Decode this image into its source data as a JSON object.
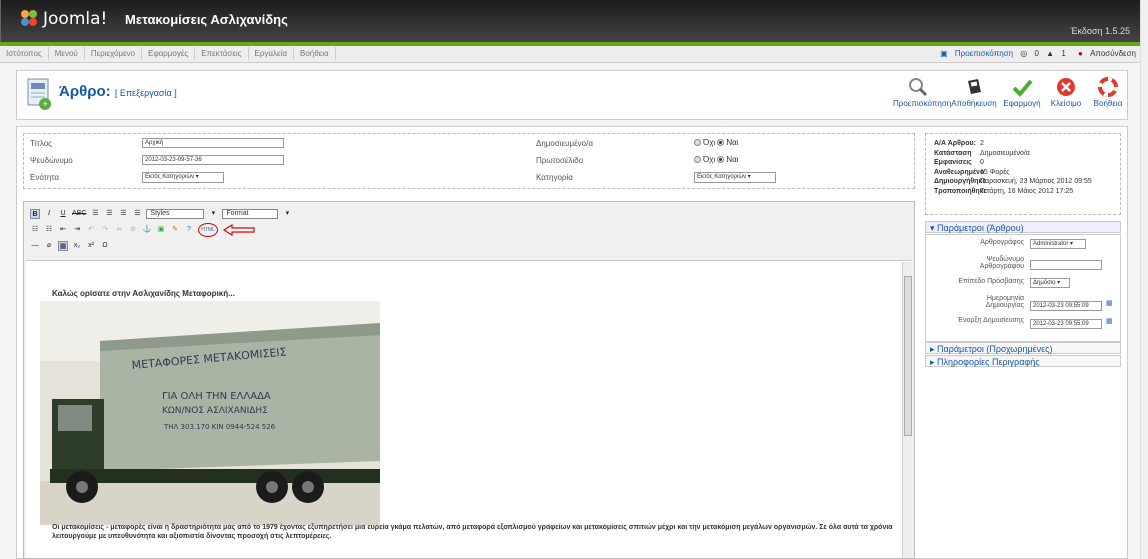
{
  "header": {
    "logo_text": "Joomla!",
    "site_name": "Μετακομίσεις Ασλιχανίδης",
    "version": "Έκδοση 1.5.25"
  },
  "menu": {
    "items": [
      "Ιστότοπος",
      "Μενού",
      "Περιεχόμενο",
      "Εφαρμογές",
      "Επεκτάσεις",
      "Εργαλεία",
      "Βοήθεια"
    ],
    "preview": "Προεπισκόπηση",
    "count1": "0",
    "count2": "1",
    "logout": "Αποσύνδεση"
  },
  "toolbar": {
    "title": "Άρθρο:",
    "subtitle": "[ Επεξεργασία ]",
    "buttons": [
      "Προεπισκόπηση",
      "Αποθήκευση",
      "Εφαρμογή",
      "Κλείσιμο",
      "Βοήθεια"
    ]
  },
  "form": {
    "title_label": "Τίτλος",
    "title_value": "Αρχική",
    "alias_label": "Ψευδώνυμο",
    "alias_value": "2012-03-23-09-57-36",
    "section_label": "Ενότητα",
    "section_value": "Εκτός Κατηγοριών",
    "published_label": "Δημοσιευμένο/α",
    "frontpage_label": "Πρωτοσέλιδο",
    "category_label": "Κατηγορία",
    "category_value": "Εκτός Κατηγοριών",
    "no": "Όχι",
    "yes": "Ναι"
  },
  "info": {
    "rows": [
      {
        "k": "Α/Α Άρθρου:",
        "v": "2"
      },
      {
        "k": "Κατάσταση",
        "v": "Δημοσιευμένο/α"
      },
      {
        "k": "Εμφανίσεις",
        "v": "0"
      },
      {
        "k": "Αναθεωρημένο",
        "v": "15 Φορές"
      },
      {
        "k": "Δημιουργήθηκε",
        "v": "Παρασκευή, 23 Μάρτιος 2012 09:55"
      },
      {
        "k": "Τροποποιήθηκε",
        "v": "Τετάρτη, 16 Μάιος 2012 17:25"
      }
    ]
  },
  "params": {
    "head1": "Παράμετροι (Άρθρου)",
    "head2": "Παράμετροι (Προχωρημένες)",
    "head3": "Πληροφορίες Περιγραφής",
    "author_label": "Αρθρογράφος",
    "author_value": "Administrator",
    "alias_label": "Ψευδώνυμο Αρθρογράφου",
    "access_label": "Επίπεδο Πρόσβασης",
    "access_value": "Δημόσιο",
    "created_label": "Ημερομηνία Δημιουργίας",
    "created_value": "2012-03-23 09:55:09",
    "publish_label": "Έναρξη Δημοσίευσης",
    "publish_value": "2012-03-23 09:55:09"
  },
  "editor": {
    "styles": "Styles",
    "format": "Format",
    "html_btn": "HTML",
    "welcome": "Καλώς ορίσατε στην Ασλιχανίδης  Μεταφορική...",
    "truck_line1": "ΜΕΤΑΦΟΡΕΣ   ΜΕΤΑΚΟΜΙΣΕΙΣ",
    "truck_line2": "ΓΙΑ ΟΛΗ ΤΗΝ ΕΛΛΑΔΑ",
    "truck_line3": "ΚΩΝ/ΝΟΣ ΑΣΛΙΧΑΝΙΔΗΣ",
    "truck_line4": "ΤΗΛ 303.170   ΚΙΝ 0944-524 526",
    "paragraph": "Οι μετακομίσεις - μεταφορές είναι η δραστηριότητα μας από το 1979 έχοντας εξυπηρετήσει μια ευρεία γκάμα πελατών, από μεταφορά εξοπλισμού γραφείων και μετακομίσεις σπιτιών μέχρι και την μετακόμιση μεγάλων οργανισμών. Σε όλα αυτά τα χρόνια λειτουργούμε με υπευθυνότητα και αξιοπιστία δίνοντας προσοχή στις λεπτομέρειες."
  }
}
